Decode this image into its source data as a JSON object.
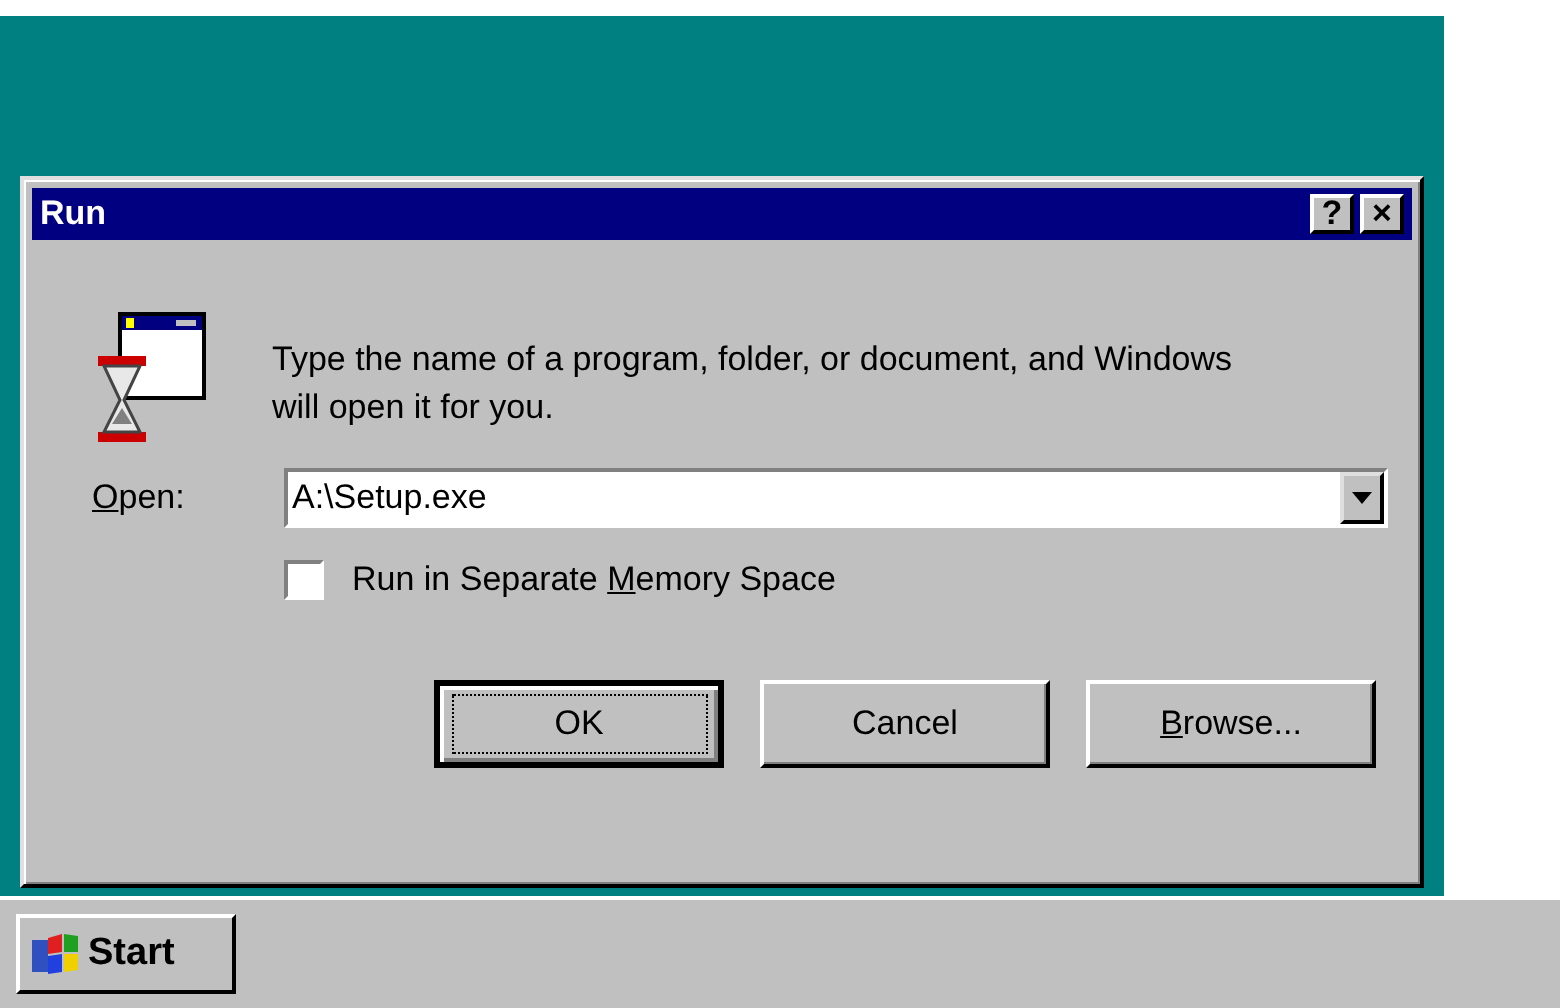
{
  "window": {
    "title": "Run",
    "title_buttons": [
      "?",
      "×"
    ]
  },
  "prompt": "Type the name of a program, folder, or document, and Windows will open it for you.",
  "open_field": {
    "label": {
      "key": "O",
      "after": "pen:"
    },
    "value": "A:\\Setup.exe"
  },
  "checkbox": {
    "label": {
      "before": "Run in Separate ",
      "key": "M",
      "after": "emory Space"
    },
    "checked": false
  },
  "buttons": [
    {
      "label": {
        "after": "OK"
      },
      "selected": true
    },
    {
      "label": {
        "after": "Cancel"
      },
      "selected": false
    },
    {
      "label": {
        "key": "B",
        "after": "rowse..."
      },
      "selected": false
    }
  ],
  "taskbar": {
    "start": "Start"
  }
}
